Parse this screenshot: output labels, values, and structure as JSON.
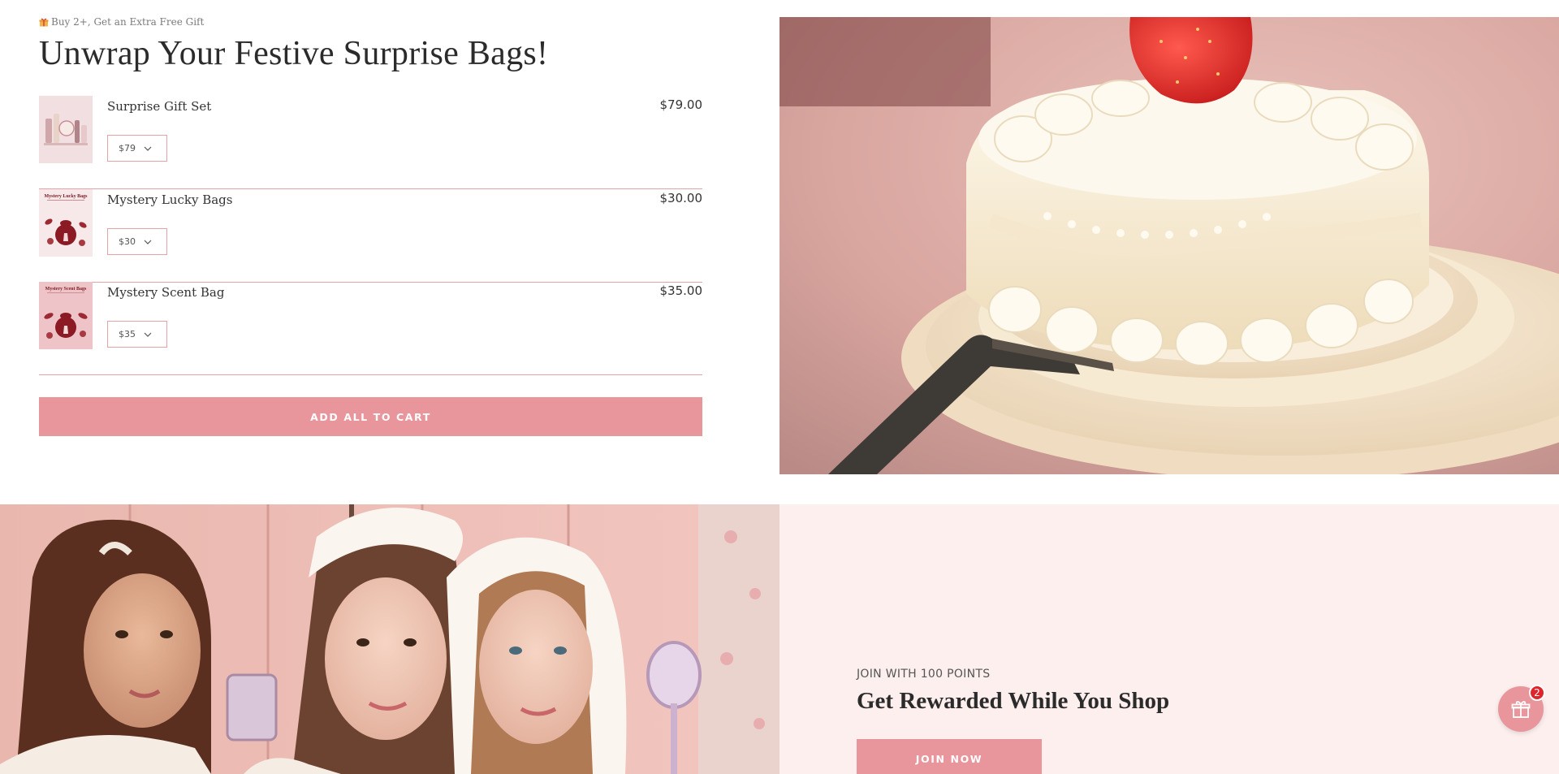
{
  "promo": {
    "text": "Buy 2+, Get an Extra Free Gift",
    "icon": "gift-icon"
  },
  "headline": "Unwrap Your Festive Surprise Bags!",
  "products": [
    {
      "name": "Surprise Gift Set",
      "price": "$79.00",
      "option": "$79",
      "thumb_title": ""
    },
    {
      "name": "Mystery Lucky Bags",
      "price": "$30.00",
      "option": "$30",
      "thumb_title": "Mystery Lucky Bags"
    },
    {
      "name": "Mystery Scent Bag",
      "price": "$35.00",
      "option": "$35",
      "thumb_title": "Mystery Scent Bags"
    }
  ],
  "add_all_label": "ADD ALL TO CART",
  "rewards": {
    "eyebrow": "JOIN WITH 100 POINTS",
    "title": "Get Rewarded While You Shop",
    "join_label": "JOIN NOW"
  },
  "fab": {
    "icon": "gift-icon",
    "badge_count": "2"
  },
  "colors": {
    "accent": "#e8959c",
    "divider": "#e4a3a6",
    "rewards_bg": "#fcefee",
    "badge": "#e0242c"
  }
}
